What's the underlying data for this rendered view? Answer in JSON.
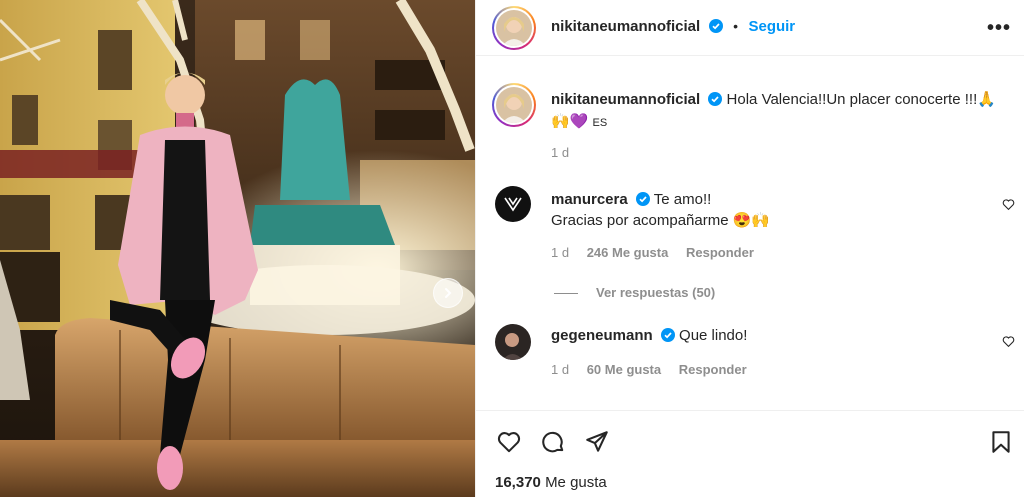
{
  "post": {
    "username": "nikitaneumannoficial",
    "separator": "•",
    "follow_label": "Seguir",
    "more_label": "•••",
    "caption": "Hola Valencia!!Un placer conocerte !!!🙏",
    "caption_line2_emoji": "🙌💜",
    "caption_line2_tag": "ES",
    "time": "1 d"
  },
  "comments": [
    {
      "username": "manurcera",
      "line1": "Te amo!!",
      "line2": "Gracias por acompañarme 😍🙌",
      "time": "1 d",
      "likes": "246 Me gusta",
      "reply": "Responder",
      "view_replies": "Ver respuestas (50)"
    },
    {
      "username": "gegeneumann",
      "line1": "Que lindo!",
      "time": "1 d",
      "likes": "60 Me gusta",
      "reply": "Responder"
    }
  ],
  "footer": {
    "likes_count": "16,370",
    "likes_label": "Me gusta"
  },
  "icons": {
    "verified": "verified-badge-icon",
    "like": "heart-icon",
    "comment": "comment-icon",
    "share": "share-icon",
    "save": "bookmark-icon",
    "next": "chevron-right-icon"
  },
  "colors": {
    "accent": "#0095f6",
    "muted": "#8e8e8e",
    "text": "#262626"
  }
}
